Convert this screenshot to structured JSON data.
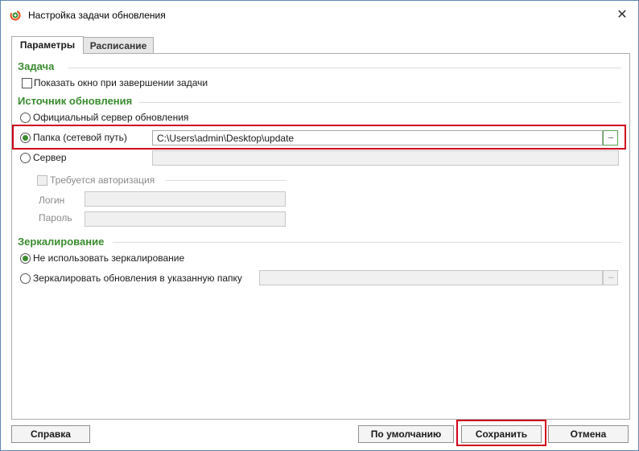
{
  "window": {
    "title": "Настройка задачи обновления",
    "close_glyph": "✕",
    "icon": "update-task-icon"
  },
  "tabs": [
    {
      "label": "Параметры",
      "active": true
    },
    {
      "label": "Расписание",
      "active": false
    }
  ],
  "task": {
    "section_title": "Задача",
    "show_window_label": "Показать окно при завершении задачи",
    "show_window_checked": false
  },
  "source": {
    "section_title": "Источник обновления",
    "official_label": "Официальный сервер обновления",
    "folder_label": "Папка (сетевой путь)",
    "folder_path": "C:\\Users\\admin\\Desktop\\update",
    "browse_label": "...",
    "server_label": "Сервер",
    "server_value": "",
    "auth_label": "Требуется авторизация",
    "login_label": "Логин",
    "login_value": "",
    "password_label": "Пароль",
    "password_value": "",
    "selected": "folder"
  },
  "mirroring": {
    "section_title": "Зеркалирование",
    "no_mirror_label": "Не использовать зеркалирование",
    "mirror_to_folder_label": "Зеркалировать обновления в указанную папку",
    "mirror_path": "",
    "browse_label": "...",
    "selected": "no_mirror"
  },
  "footer": {
    "help_label": "Справка",
    "default_label": "По умолчанию",
    "save_label": "Сохранить",
    "cancel_label": "Отмена"
  },
  "colors": {
    "section_title": "#3a8b2f",
    "radio_checked": "#3a8b2f",
    "highlight": "#d0021b",
    "window_border": "#5f87b5"
  }
}
